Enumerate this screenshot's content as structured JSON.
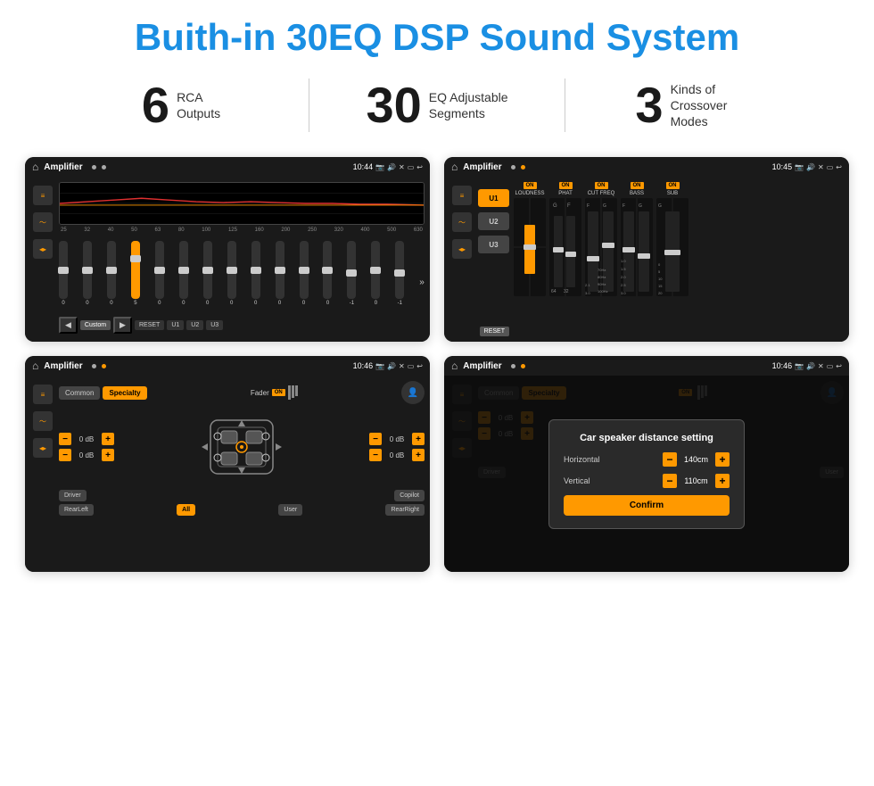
{
  "header": {
    "title": "Buith-in 30EQ DSP Sound System"
  },
  "stats": [
    {
      "number": "6",
      "label": "RCA\nOutputs"
    },
    {
      "number": "30",
      "label": "EQ Adjustable\nSegments"
    },
    {
      "number": "3",
      "label": "Kinds of\nCrossover Modes"
    }
  ],
  "screens": {
    "eq": {
      "title": "Amplifier",
      "time": "10:44",
      "freqs": [
        "25",
        "32",
        "40",
        "50",
        "63",
        "80",
        "100",
        "125",
        "160",
        "200",
        "250",
        "320",
        "400",
        "500",
        "630"
      ],
      "values": [
        "0",
        "0",
        "0",
        "5",
        "0",
        "0",
        "0",
        "0",
        "0",
        "0",
        "0",
        "0",
        "-1",
        "0",
        "-1"
      ],
      "preset": "Custom",
      "buttons": [
        "RESET",
        "U1",
        "U2",
        "U3"
      ]
    },
    "dsp": {
      "title": "Amplifier",
      "time": "10:45",
      "presets": [
        "U1",
        "U2",
        "U3"
      ],
      "channels": [
        "LOUDNESS",
        "PHAT",
        "CUT FREQ",
        "BASS",
        "SUB"
      ],
      "reset_label": "RESET"
    },
    "cs": {
      "title": "Amplifier",
      "time": "10:46",
      "tabs": [
        "Common",
        "Specialty"
      ],
      "fader_label": "Fader",
      "on_label": "ON",
      "vol1": "0 dB",
      "vol2": "0 dB",
      "vol3": "0 dB",
      "vol4": "0 dB",
      "bottom_btns": [
        "Driver",
        "",
        "Copilot",
        "RearLeft",
        "All",
        "User",
        "RearRight"
      ]
    },
    "dialog": {
      "title": "Amplifier",
      "time": "10:46",
      "tabs": [
        "Common",
        "Specialty"
      ],
      "on_label": "ON",
      "dlg_title": "Car speaker distance setting",
      "horizontal_label": "Horizontal",
      "horizontal_value": "140cm",
      "vertical_label": "Vertical",
      "vertical_value": "110cm",
      "confirm_label": "Confirm",
      "vol1": "0 dB",
      "vol2": "0 dB"
    }
  }
}
